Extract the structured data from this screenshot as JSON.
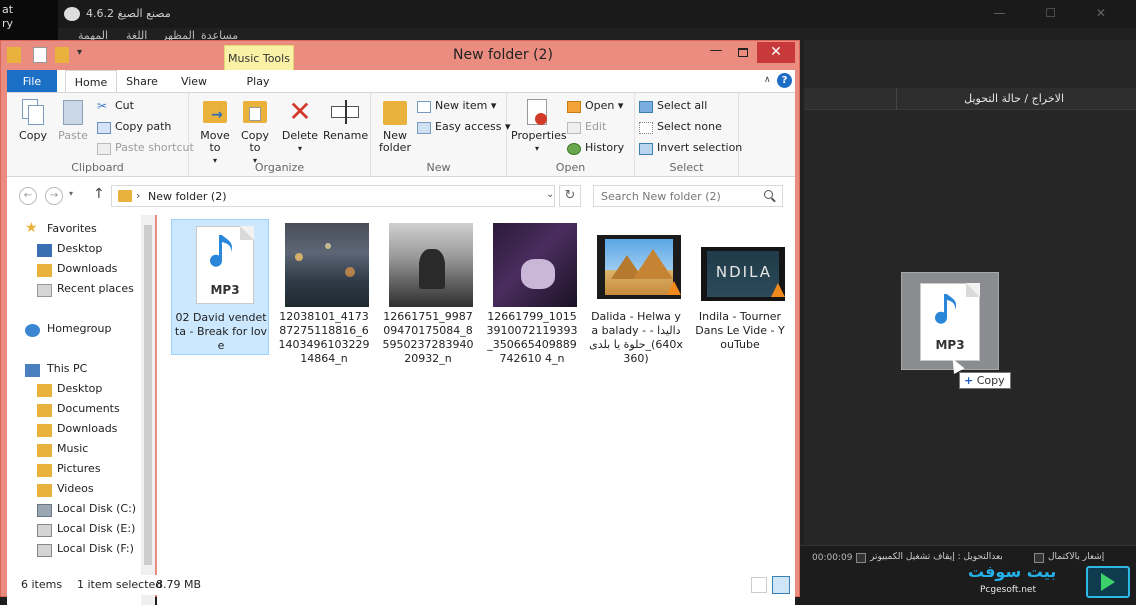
{
  "background_app": {
    "title": "مصنع الصيغ 4.6.2",
    "left_strip": [
      "at",
      "ry"
    ],
    "menu": [
      "المهمة",
      "اللغة",
      "المظهر",
      "مساعدة"
    ],
    "column_header": "الاخراج / حالة التحويل",
    "timer": "00:00:09",
    "status_after": "بعدالتحويل : إيقاف تشغيل الكمبيوتر",
    "status_notify": "إشعار بالاكتمال",
    "watermark": "بيت سوفت",
    "watermark_sub": "Pcgesoft.net",
    "drag_tooltip": "Copy"
  },
  "explorer": {
    "title": "New folder (2)",
    "context_tab": "Music Tools",
    "tabs": [
      "File",
      "Home",
      "Share",
      "View",
      "Play"
    ],
    "ribbon": {
      "clipboard": {
        "label": "Clipboard",
        "copy": "Copy",
        "paste": "Paste",
        "cut": "Cut",
        "copy_path": "Copy path",
        "paste_shortcut": "Paste shortcut"
      },
      "organize": {
        "label": "Organize",
        "move_to": "Move to",
        "copy_to": "Copy to",
        "delete": "Delete",
        "rename": "Rename"
      },
      "new": {
        "label": "New",
        "new_folder": "New folder",
        "new_item": "New item",
        "easy_access": "Easy access"
      },
      "open": {
        "label": "Open",
        "properties": "Properties",
        "open": "Open",
        "edit": "Edit",
        "history": "History"
      },
      "select": {
        "label": "Select",
        "select_all": "Select all",
        "select_none": "Select none",
        "invert_selection": "Invert selection"
      }
    },
    "address": "New folder (2)",
    "search_placeholder": "Search New folder (2)",
    "nav": {
      "favorites": "Favorites",
      "fav_items": [
        "Desktop",
        "Downloads",
        "Recent places"
      ],
      "homegroup": "Homegroup",
      "this_pc": "This PC",
      "pc_items": [
        "Desktop",
        "Documents",
        "Downloads",
        "Music",
        "Pictures",
        "Videos",
        "Local Disk (C:)",
        "Local Disk (E:)",
        "Local Disk (F:)"
      ]
    },
    "files": [
      {
        "name": "02 David vendetta - Break for love",
        "type": "mp3"
      },
      {
        "name": "12038101_417387275118816_6140349610322914864_n",
        "type": "image"
      },
      {
        "name": "12661751_998709470175084_8595023728394020932_n",
        "type": "image"
      },
      {
        "name": "12661799_10153910072119393_350665409889742610 4_n",
        "type": "image"
      },
      {
        "name": "Dalida - Helwa ya balady - داليدا - حلوة يا بلدى_(640x360)",
        "type": "video"
      },
      {
        "name": "Indila - Tourner Dans Le Vide - YouTube",
        "type": "video"
      }
    ],
    "mp3_label": "MP3",
    "thumb_text": {
      "indila": "NDILA"
    },
    "status": {
      "count": "6 items",
      "selected": "1 item selected",
      "size": "8.79 MB"
    }
  },
  "colors": {
    "title_frame": "#ea8d80",
    "file_tab": "#1b6fc4",
    "close": "#c7393a",
    "selection": "#cce8ff",
    "music_tools": "#f9f2a6"
  }
}
